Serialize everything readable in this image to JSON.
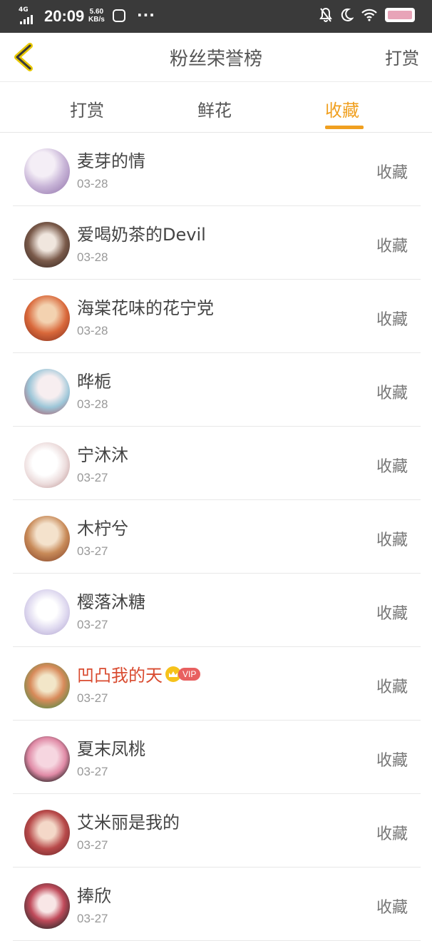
{
  "status_bar": {
    "network": "4G",
    "network_sup": "HD",
    "time": "20:09",
    "speed_value": "5.60",
    "speed_unit": "KB/s",
    "more": "···"
  },
  "header": {
    "title": "粉丝荣誉榜",
    "right_action": "打赏",
    "back_icon": "chevron-left-icon",
    "accent_color": "#f0a020"
  },
  "tabs": [
    {
      "label": "打赏",
      "active": false
    },
    {
      "label": "鲜花",
      "active": false
    },
    {
      "label": "收藏",
      "active": true
    }
  ],
  "list": {
    "items": [
      {
        "name": "麦芽的情",
        "date": "03-28",
        "action": "收藏",
        "vip": false
      },
      {
        "name": "爱喝奶茶的Devil",
        "date": "03-28",
        "action": "收藏",
        "vip": false
      },
      {
        "name": "海棠花味的花宁党",
        "date": "03-28",
        "action": "收藏",
        "vip": false
      },
      {
        "name": "晔栀",
        "date": "03-28",
        "action": "收藏",
        "vip": false
      },
      {
        "name": "宁沐沐",
        "date": "03-27",
        "action": "收藏",
        "vip": false
      },
      {
        "name": "木柠兮",
        "date": "03-27",
        "action": "收藏",
        "vip": false
      },
      {
        "name": "樱落沐糖",
        "date": "03-27",
        "action": "收藏",
        "vip": false
      },
      {
        "name": "凹凸我的天",
        "date": "03-27",
        "action": "收藏",
        "vip": true,
        "vip_label": "VIP"
      },
      {
        "name": "夏末凤桃",
        "date": "03-27",
        "action": "收藏",
        "vip": false
      },
      {
        "name": "艾米丽是我的",
        "date": "03-27",
        "action": "收藏",
        "vip": false
      },
      {
        "name": "捧欣",
        "date": "03-27",
        "action": "收藏",
        "vip": false
      }
    ]
  }
}
